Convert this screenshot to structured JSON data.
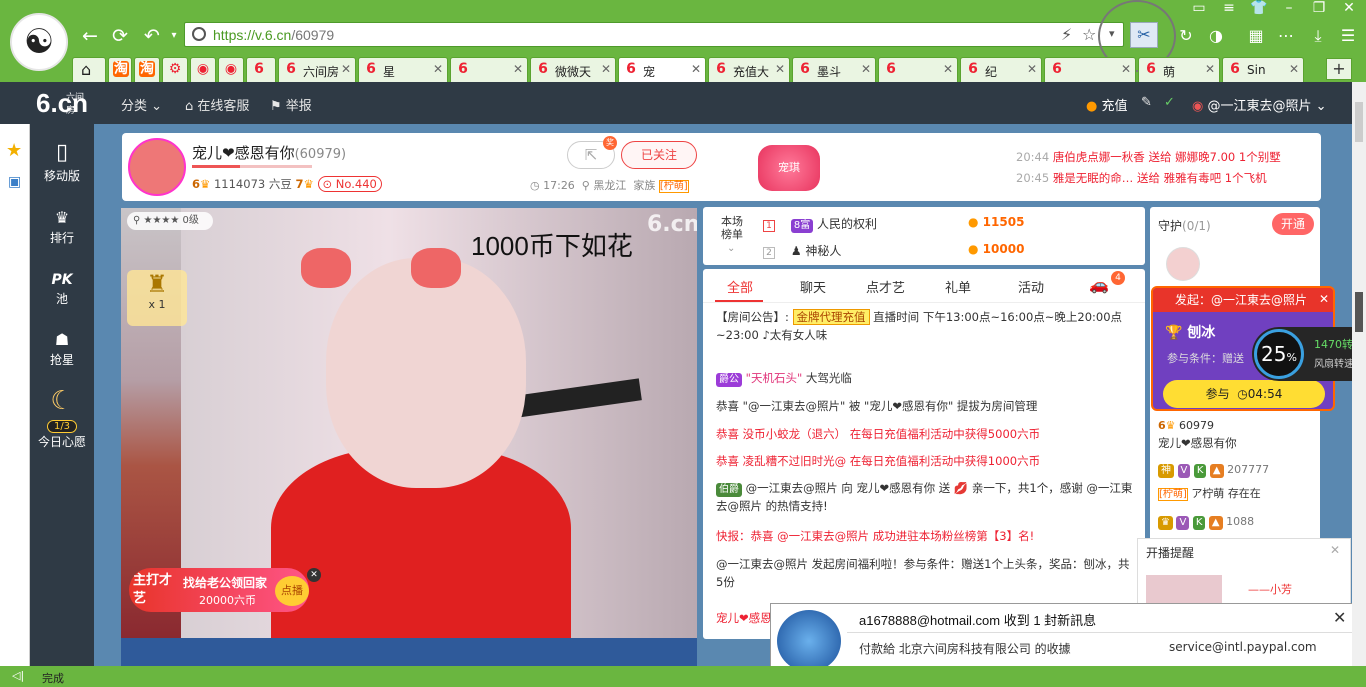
{
  "browser": {
    "url_host": "https://v.6.cn",
    "url_path": "/60979",
    "tabs": [
      {
        "label": "淘",
        "icon": "淘"
      },
      {
        "label": "淘",
        "icon": "淘"
      },
      {
        "label": "",
        "icon": "⚙"
      },
      {
        "label": "",
        "icon": "◉"
      },
      {
        "label": "",
        "icon": "◉"
      },
      {
        "label": "",
        "icon": "6"
      },
      {
        "label": "六间房",
        "icon": "6"
      },
      {
        "label": "星",
        "icon": "6"
      },
      {
        "label": "",
        "icon": "6"
      },
      {
        "label": "微微天",
        "icon": "6"
      },
      {
        "label": "宠",
        "icon": "6"
      },
      {
        "label": "充值大",
        "icon": "6"
      },
      {
        "label": "墨斗",
        "icon": "6"
      },
      {
        "label": "",
        "icon": "6"
      },
      {
        "label": "纪",
        "icon": "6"
      },
      {
        "label": "",
        "icon": "6"
      },
      {
        "label": "萌",
        "icon": "6"
      },
      {
        "label": "Sin",
        "icon": "6"
      }
    ],
    "status_text": "完成"
  },
  "site": {
    "logo_main": "6.cn",
    "logo_sub": "六间房",
    "nav": {
      "category": "分类",
      "service": "在线客服",
      "report": "举报"
    },
    "recharge": "充值",
    "user": "@一江東去@照片",
    "left_menu": [
      {
        "label": "移动版",
        "icon": "▯"
      },
      {
        "label": "排行",
        "icon": "♛"
      },
      {
        "label": "池",
        "icon": "PK"
      },
      {
        "label": "抢星",
        "icon": "☗"
      },
      {
        "label": "今日心愿",
        "icon": "☾"
      }
    ],
    "wish_count": "1/3"
  },
  "anchor": {
    "name": "宠儿❤感恩有你",
    "room_id": "(60979)",
    "level": "6",
    "beans": "1114073 六豆",
    "fans_level": "7",
    "rank_badge": "No.440",
    "followed": "已关注",
    "new_badge": "奖",
    "time": "17:26",
    "location": "黑龙江",
    "family": "家族",
    "family_tag": "[柠萌]",
    "pet_label": "宠琪",
    "gifts": [
      {
        "time": "20:44",
        "text": "唐伯虎点娜一秋香 送给 娜娜晚7.00 1个别墅"
      },
      {
        "time": "20:45",
        "text": "雅是无眠的命… 送给 雅雅有毒吧 1个飞机"
      }
    ]
  },
  "video": {
    "overlay_text": "1000币下如花",
    "watermark": "6.cn",
    "viewer_level": "0级",
    "gift_count": "x 1",
    "promo_left": "主打才艺",
    "promo_text": "找给老公领回家",
    "promo_price": "20000六币",
    "promo_btn": "点播"
  },
  "rank": {
    "title": "本场榜单",
    "rows": [
      {
        "pos": "1",
        "tag": "8富",
        "name": "人民的权利",
        "score": "11505"
      },
      {
        "pos": "2",
        "tag": "",
        "name": "神秘人",
        "score": "10000"
      }
    ]
  },
  "chat": {
    "tabs": [
      "全部",
      "聊天",
      "点才艺",
      "礼单",
      "活动"
    ],
    "badge": "4",
    "messages": [
      {
        "kind": "notice",
        "text": "【房间公告】:",
        "tag": "金牌代理充值",
        "tail": " 直播时间 下午13:00点~16:00点~晚上20:00点~23:00 ♪太有女人味"
      },
      {
        "kind": "enter",
        "tag": "爵公",
        "name": "\"天机石头\"",
        "text": " 大驾光临"
      },
      {
        "kind": "plain",
        "text": "恭喜 \"@一江東去@照片\" 被 \"宠儿❤感恩有你\" 提拔为房间管理"
      },
      {
        "kind": "red",
        "text": "恭喜 没币小蛟龙（退六） 在每日充值福利活动中获得5000六币"
      },
      {
        "kind": "red",
        "text": "恭喜 凌乱糟不过旧时光@ 在每日充值福利活动中获得1000六币"
      },
      {
        "kind": "gift",
        "tag": "伯爵",
        "text": "@一江東去@照片 向 宠儿❤感恩有你 送 💋 亲一下，共1个，感谢 @一江東去@照片 的热情支持!"
      },
      {
        "kind": "red",
        "text": "快报：恭喜 @一江東去@照片 成功进驻本场粉丝榜第【3】名!"
      },
      {
        "kind": "plain",
        "text": "@一江東去@照片 发起房间福利啦！参与条件：赠送1个上头条，奖品：刨冰，共5份"
      },
      {
        "kind": "red",
        "text": "宠儿❤感恩"
      }
    ]
  },
  "guard": {
    "title": "守护",
    "count": "(0/1)",
    "btn": "开通",
    "user_level": "60979",
    "user_name": "宠儿❤感恩有你",
    "fan_tag": "神",
    "fan_num": "207777",
    "fan_name": "ア柠萌",
    "fan_status": "存在在",
    "fan2_num": "1088"
  },
  "event": {
    "title": "发起：@一江東去@照片",
    "prize": "刨冰",
    "cond": "参与条件：赠送",
    "btn": "参与",
    "timer": "04:54"
  },
  "speed": {
    "percent": "25",
    "unit": "%",
    "rpm": "1470转",
    "label": "风扇转速"
  },
  "kaibo": {
    "title": "开播提醒",
    "name": "——小芳"
  },
  "notify": {
    "title": "a1678888@hotmail.com 收到 1 封新訊息",
    "body": "付款給 北京六间房科技有限公司 的收據",
    "from": "service@intl.paypal.com"
  }
}
